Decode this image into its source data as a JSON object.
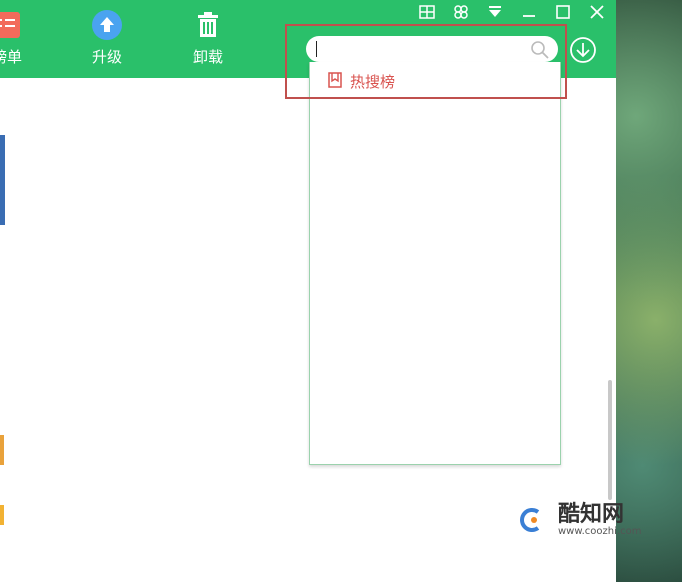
{
  "toolbar": {
    "items": [
      {
        "label": "榜单",
        "icon": "list-icon"
      },
      {
        "label": "升级",
        "icon": "upgrade-arrow-icon"
      },
      {
        "label": "卸载",
        "icon": "trash-icon"
      }
    ]
  },
  "window_controls": [
    "grid-icon",
    "skin-icon",
    "menu-triangle-icon",
    "minimize-icon",
    "maximize-icon",
    "close-icon"
  ],
  "search": {
    "value": "",
    "placeholder": ""
  },
  "dropdown": {
    "items": [
      {
        "label": "热搜榜",
        "icon": "bookmark-icon"
      }
    ]
  },
  "watermark": {
    "title": "酷知网",
    "url": "www.coozhi.com"
  },
  "colors": {
    "green": "#2ac06a",
    "accent_red": "#d9534f",
    "highlight_box": "#c0504d"
  }
}
